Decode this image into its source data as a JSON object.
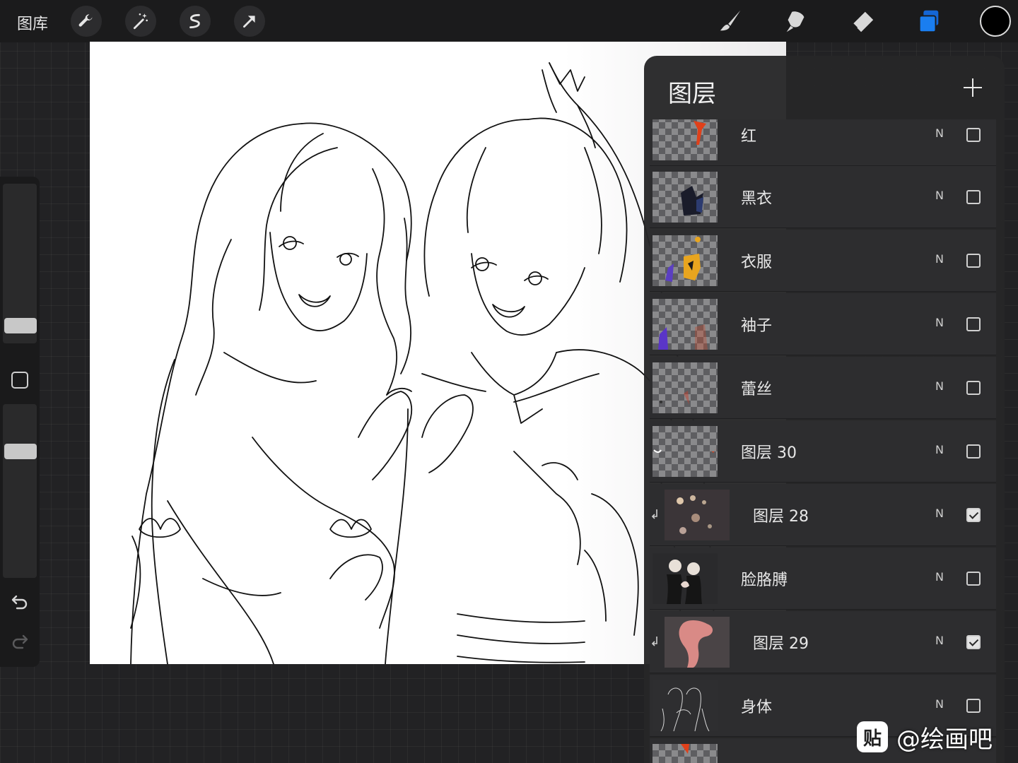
{
  "topbar": {
    "gallery_label": "图库",
    "left_tools": [
      "wrench-icon",
      "magic-wand-icon",
      "selection-icon",
      "transform-arrow-icon"
    ],
    "right_tools": [
      "brush-icon",
      "smudge-icon",
      "eraser-icon",
      "layers-icon"
    ],
    "active_tool": "layers-icon",
    "active_color": "#000000",
    "accent_color": "#1a73e8"
  },
  "sidebar": {
    "brush_size_level": 0.3,
    "opacity_level": 0.75,
    "controls": [
      "modifier-square-icon",
      "undo-icon",
      "redo-icon"
    ]
  },
  "layers_panel": {
    "title": "图层",
    "add_button": "plus-icon",
    "layers": [
      {
        "name": "红",
        "blend": "N",
        "visible": false,
        "clipped": false
      },
      {
        "name": "黑衣",
        "blend": "N",
        "visible": false,
        "clipped": false
      },
      {
        "name": "衣服",
        "blend": "N",
        "visible": false,
        "clipped": false
      },
      {
        "name": "袖子",
        "blend": "N",
        "visible": false,
        "clipped": false
      },
      {
        "name": "蕾丝",
        "blend": "N",
        "visible": false,
        "clipped": false
      },
      {
        "name": "图层 30",
        "blend": "N",
        "visible": false,
        "clipped": false
      },
      {
        "name": "图层 28",
        "blend": "N",
        "visible": true,
        "clipped": true
      },
      {
        "name": "脸胳膊",
        "blend": "N",
        "visible": false,
        "clipped": false
      },
      {
        "name": "图层 29",
        "blend": "N",
        "visible": true,
        "clipped": true
      },
      {
        "name": "身体",
        "blend": "N",
        "visible": false,
        "clipped": false
      }
    ]
  },
  "watermark": {
    "icon_text": "贴",
    "text": "@绘画吧"
  }
}
